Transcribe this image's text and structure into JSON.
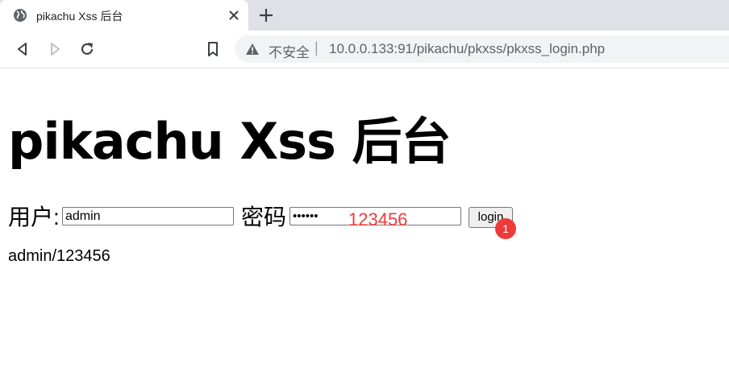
{
  "browser": {
    "tab": {
      "title": "pikachu Xss 后台",
      "icon": "globe-icon",
      "close_icon": "close-icon"
    },
    "new_tab_icon": "plus-icon",
    "toolbar": {
      "back_icon": "back-icon",
      "forward_icon": "forward-icon",
      "reload_icon": "reload-icon",
      "bookmark_icon": "bookmark-icon"
    },
    "address_bar": {
      "security_icon": "warning-icon",
      "security_label": "不安全",
      "separator": "|",
      "url": "10.0.0.133:91/pikachu/pkxss/pkxss_login.php"
    }
  },
  "page": {
    "title": "pikachu Xss 后台",
    "form": {
      "username_label": "用户:",
      "username_value": "admin",
      "password_label": "密码",
      "password_masked": "••••••",
      "password_annotation": "123456",
      "login_label": "login",
      "step_badge": "1"
    },
    "hint": "admin/123456"
  },
  "colors": {
    "annotation": "#ef3a3a",
    "tabstrip": "#dee1e6",
    "omnibox": "#f1f3f4"
  }
}
